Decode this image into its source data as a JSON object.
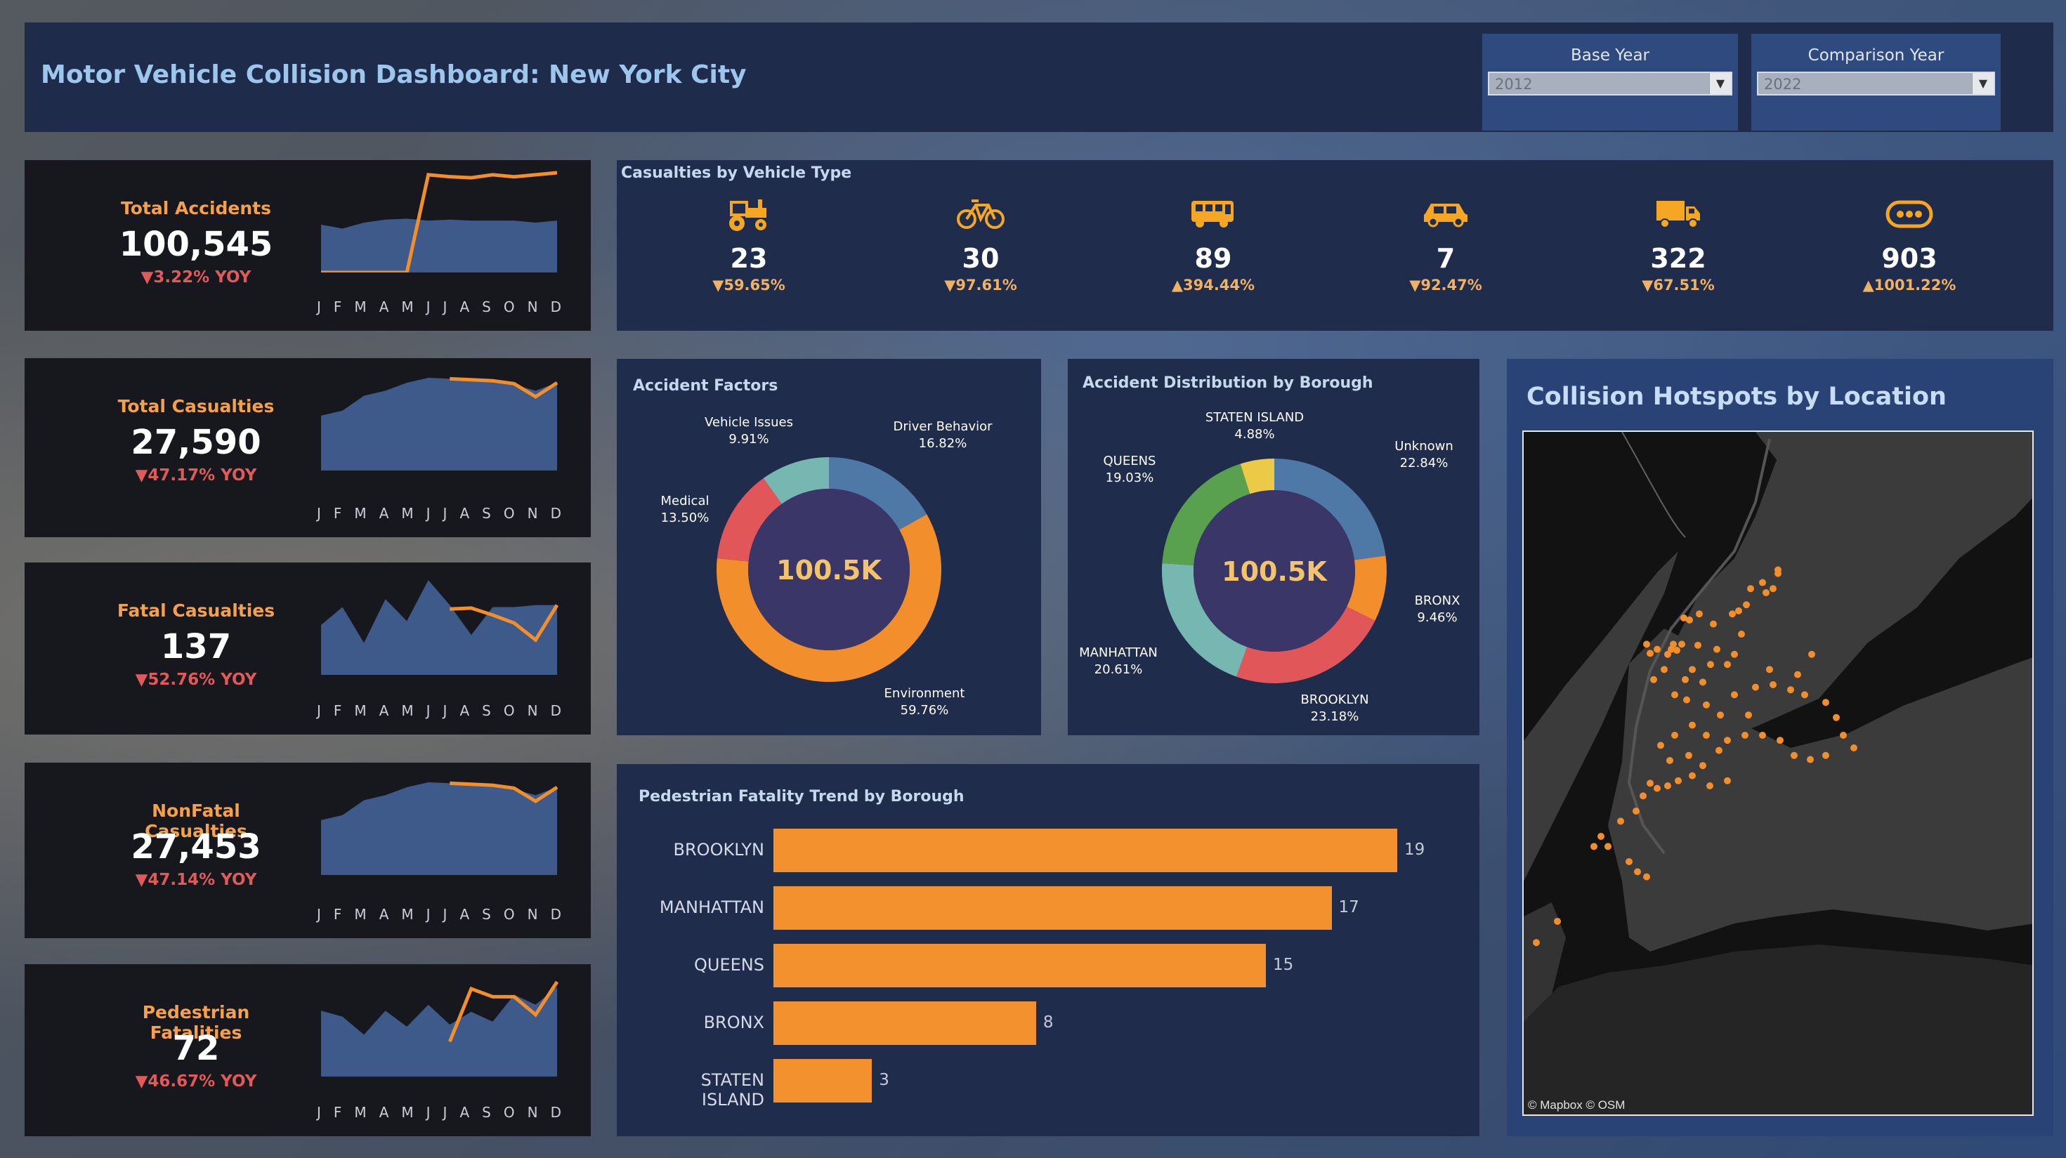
{
  "header": {
    "title": "Motor Vehicle Collision Dashboard: New York City",
    "base_year": {
      "label": "Base Year",
      "value": "2012"
    },
    "comparison_year": {
      "label": "Comparison Year",
      "value": "2022"
    }
  },
  "months": [
    "J",
    "F",
    "M",
    "A",
    "M",
    "J",
    "J",
    "A",
    "S",
    "O",
    "N",
    "D"
  ],
  "kpis": [
    {
      "name": "Total Accidents",
      "value": "100,545",
      "yoy": "▼3.22% YOY",
      "area": [
        0.48,
        0.44,
        0.5,
        0.53,
        0.54,
        0.52,
        0.53,
        0.52,
        0.52,
        0.52,
        0.5,
        0.52
      ],
      "line": [
        null,
        null,
        null,
        null,
        null,
        0.98,
        0.96,
        0.95,
        0.98,
        0.96,
        0.98,
        1.0
      ]
    },
    {
      "name": "Total Casualties",
      "value": "27,590",
      "yoy": "▼47.17% YOY",
      "area": [
        0.55,
        0.6,
        0.75,
        0.8,
        0.88,
        0.93,
        0.92,
        0.9,
        0.89,
        0.86,
        0.8,
        0.88
      ],
      "line": [
        null,
        null,
        null,
        null,
        null,
        null,
        0.92,
        0.91,
        0.9,
        0.87,
        0.74,
        0.88
      ]
    },
    {
      "name": "Fatal Casualties",
      "value": "137",
      "yoy": "▼52.76% YOY",
      "area": [
        0.5,
        0.68,
        0.32,
        0.76,
        0.54,
        0.95,
        0.7,
        0.4,
        0.68,
        0.68,
        0.7,
        0.7
      ],
      "line": [
        null,
        null,
        null,
        null,
        null,
        null,
        0.66,
        0.67,
        0.6,
        0.52,
        0.35,
        0.7
      ]
    },
    {
      "name": "NonFatal Casualties",
      "value": "27,453",
      "yoy": "▼47.14% YOY",
      "area": [
        0.55,
        0.6,
        0.75,
        0.8,
        0.88,
        0.93,
        0.92,
        0.9,
        0.89,
        0.86,
        0.8,
        0.88
      ],
      "line": [
        null,
        null,
        null,
        null,
        null,
        null,
        0.92,
        0.91,
        0.9,
        0.87,
        0.74,
        0.88
      ]
    },
    {
      "name": "Pedestrian Fatalities",
      "value": "72",
      "yoy": "▼46.67% YOY",
      "area": [
        0.66,
        0.6,
        0.42,
        0.66,
        0.5,
        0.72,
        0.52,
        0.65,
        0.55,
        0.82,
        0.72,
        0.9
      ],
      "line": [
        null,
        null,
        null,
        null,
        null,
        null,
        0.35,
        0.88,
        0.8,
        0.8,
        0.62,
        0.95
      ]
    }
  ],
  "vehicle": {
    "title": "Casualties by Vehicle Type",
    "items": [
      {
        "icon": "tractor-icon",
        "value": "23",
        "change": "▼59.65%"
      },
      {
        "icon": "bicycle-icon",
        "value": "30",
        "change": "▼97.61%"
      },
      {
        "icon": "bus-icon",
        "value": "89",
        "change": "▲394.44%"
      },
      {
        "icon": "car-icon",
        "value": "7",
        "change": "▼92.47%"
      },
      {
        "icon": "truck-icon",
        "value": "322",
        "change": "▼67.51%"
      },
      {
        "icon": "more-icon",
        "value": "903",
        "change": "▲1001.22%"
      }
    ]
  },
  "factors": {
    "title": "Accident Factors",
    "center": "100.5K",
    "slices": [
      {
        "name": "Driver Behavior",
        "pct": "16.82%",
        "value": 16.82,
        "color": "#4e79a7"
      },
      {
        "name": "Environment",
        "pct": "59.76%",
        "value": 59.76,
        "color": "#f28e2b"
      },
      {
        "name": "Medical",
        "pct": "13.50%",
        "value": 13.5,
        "color": "#e15759"
      },
      {
        "name": "Vehicle Issues",
        "pct": "9.91%",
        "value": 9.91,
        "color": "#76b7b2"
      }
    ]
  },
  "borough": {
    "title": "Accident Distribution by Borough",
    "center": "100.5K",
    "slices": [
      {
        "name": "Unknown",
        "pct": "22.84%",
        "value": 22.84,
        "color": "#4e79a7"
      },
      {
        "name": "BRONX",
        "pct": "9.46%",
        "value": 9.46,
        "color": "#f28e2b"
      },
      {
        "name": "BROOKLYN",
        "pct": "23.18%",
        "value": 23.18,
        "color": "#e15759"
      },
      {
        "name": "MANHATTAN",
        "pct": "20.61%",
        "value": 20.61,
        "color": "#76b7b2"
      },
      {
        "name": "QUEENS",
        "pct": "19.03%",
        "value": 19.03,
        "color": "#59a14f"
      },
      {
        "name": "STATEN ISLAND",
        "pct": "4.88%",
        "value": 4.88,
        "color": "#edc948"
      }
    ]
  },
  "pedestrian": {
    "title": "Pedestrian Fatality Trend by Borough",
    "bars": [
      {
        "label": "BROOKLYN",
        "value": 19
      },
      {
        "label": "MANHATTAN",
        "value": 17
      },
      {
        "label": "QUEENS",
        "value": 15
      },
      {
        "label": "BRONX",
        "value": 8
      },
      {
        "label": "STATEN ISLAND",
        "value": 3
      }
    ]
  },
  "map": {
    "title": "Collision Hotspots by Location",
    "credit": "© Mapbox © OSM"
  },
  "chart_data": [
    {
      "type": "pie",
      "title": "Accident Factors",
      "categories": [
        "Driver Behavior",
        "Environment",
        "Medical",
        "Vehicle Issues"
      ],
      "values": [
        16.82,
        59.76,
        13.5,
        9.91
      ]
    },
    {
      "type": "pie",
      "title": "Accident Distribution by Borough",
      "categories": [
        "Unknown",
        "BRONX",
        "BROOKLYN",
        "MANHATTAN",
        "QUEENS",
        "STATEN ISLAND"
      ],
      "values": [
        22.84,
        9.46,
        23.18,
        20.61,
        19.03,
        4.88
      ]
    },
    {
      "type": "bar",
      "title": "Pedestrian Fatality Trend by Borough",
      "categories": [
        "BROOKLYN",
        "MANHATTAN",
        "QUEENS",
        "BRONX",
        "STATEN ISLAND"
      ],
      "values": [
        19,
        17,
        15,
        8,
        3
      ]
    }
  ]
}
